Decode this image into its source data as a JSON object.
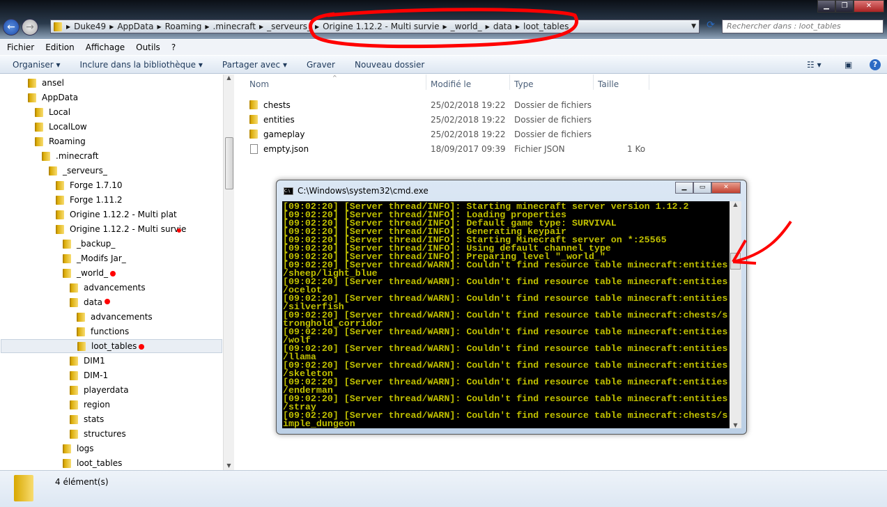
{
  "window": {
    "controls": [
      "minimize",
      "maximize",
      "close"
    ]
  },
  "address": {
    "crumbs": [
      "Duke49",
      "AppData",
      "Roaming",
      ".minecraft",
      "_serveurs_",
      "Origine 1.12.2 - Multi survie",
      "_world_",
      "data",
      "loot_tables"
    ],
    "search_placeholder": "Rechercher dans : loot_tables"
  },
  "menu": [
    "Fichier",
    "Edition",
    "Affichage",
    "Outils",
    "?"
  ],
  "toolbar": {
    "organiser": "Organiser ▾",
    "inclure": "Inclure dans la bibliothèque ▾",
    "partager": "Partager avec ▾",
    "graver": "Graver",
    "nouveau": "Nouveau dossier"
  },
  "tree": [
    {
      "label": "ansel",
      "level": 0
    },
    {
      "label": "AppData",
      "level": 0
    },
    {
      "label": "Local",
      "level": 1
    },
    {
      "label": "LocalLow",
      "level": 1
    },
    {
      "label": "Roaming",
      "level": 1
    },
    {
      "label": ".minecraft",
      "level": 2
    },
    {
      "label": "_serveurs_",
      "level": 3
    },
    {
      "label": "Forge 1.7.10",
      "level": 4
    },
    {
      "label": "Forge 1.11.2",
      "level": 4
    },
    {
      "label": "Origine 1.12.2 - Multi plat",
      "level": 4
    },
    {
      "label": "Origine 1.12.2 - Multi survie",
      "level": 4
    },
    {
      "label": "_backup_",
      "level": 5
    },
    {
      "label": "_Modifs Jar_",
      "level": 5
    },
    {
      "label": "_world_",
      "level": 5
    },
    {
      "label": "advancements",
      "level": 6
    },
    {
      "label": "data",
      "level": 6
    },
    {
      "label": "advancements",
      "level": 7
    },
    {
      "label": "functions",
      "level": 7
    },
    {
      "label": "loot_tables",
      "level": 7,
      "selected": true
    },
    {
      "label": "DIM1",
      "level": 6
    },
    {
      "label": "DIM-1",
      "level": 6
    },
    {
      "label": "playerdata",
      "level": 6
    },
    {
      "label": "region",
      "level": 6
    },
    {
      "label": "stats",
      "level": 6
    },
    {
      "label": "structures",
      "level": 6
    },
    {
      "label": "logs",
      "level": 5
    },
    {
      "label": "loot_tables",
      "level": 5
    }
  ],
  "columns": [
    "Nom",
    "Modifié le",
    "Type",
    "Taille"
  ],
  "files": [
    {
      "name": "chests",
      "date": "25/02/2018 19:22",
      "type": "Dossier de fichiers",
      "size": "",
      "icon": "folder"
    },
    {
      "name": "entities",
      "date": "25/02/2018 19:22",
      "type": "Dossier de fichiers",
      "size": "",
      "icon": "folder"
    },
    {
      "name": "gameplay",
      "date": "25/02/2018 19:22",
      "type": "Dossier de fichiers",
      "size": "",
      "icon": "folder"
    },
    {
      "name": "empty.json",
      "date": "18/09/2017 09:39",
      "type": "Fichier JSON",
      "size": "1 Ko",
      "icon": "file"
    }
  ],
  "status": {
    "count": "4 élément(s)"
  },
  "cmd": {
    "title": "C:\\Windows\\system32\\cmd.exe",
    "lines": [
      "[09:02:20] [Server thread/INFO]: Starting minecraft server version 1.12.2",
      "[09:02:20] [Server thread/INFO]: Loading properties",
      "[09:02:20] [Server thread/INFO]: Default game type: SURVIVAL",
      "[09:02:20] [Server thread/INFO]: Generating keypair",
      "[09:02:20] [Server thread/INFO]: Starting Minecraft server on *:25565",
      "[09:02:20] [Server thread/INFO]: Using default channel type",
      "[09:02:20] [Server thread/INFO]: Preparing level \"_world_\"",
      "[09:02:20] [Server thread/WARN]: Couldn't find resource table minecraft:entities",
      "/sheep/light_blue",
      "[09:02:20] [Server thread/WARN]: Couldn't find resource table minecraft:entities",
      "/ocelot",
      "[09:02:20] [Server thread/WARN]: Couldn't find resource table minecraft:entities",
      "/silverfish",
      "[09:02:20] [Server thread/WARN]: Couldn't find resource table minecraft:chests/s",
      "tronghold_corridor",
      "[09:02:20] [Server thread/WARN]: Couldn't find resource table minecraft:entities",
      "/wolf",
      "[09:02:20] [Server thread/WARN]: Couldn't find resource table minecraft:entities",
      "/llama",
      "[09:02:20] [Server thread/WARN]: Couldn't find resource table minecraft:entities",
      "/skeleton",
      "[09:02:20] [Server thread/WARN]: Couldn't find resource table minecraft:entities",
      "/enderman",
      "[09:02:20] [Server thread/WARN]: Couldn't find resource table minecraft:entities",
      "/stray",
      "[09:02:20] [Server thread/WARN]: Couldn't find resource table minecraft:chests/s",
      "imple_dungeon"
    ]
  },
  "colors": {
    "console_text": "#c0c000",
    "annotation": "#ff0000",
    "selection": "#e9eef4"
  }
}
